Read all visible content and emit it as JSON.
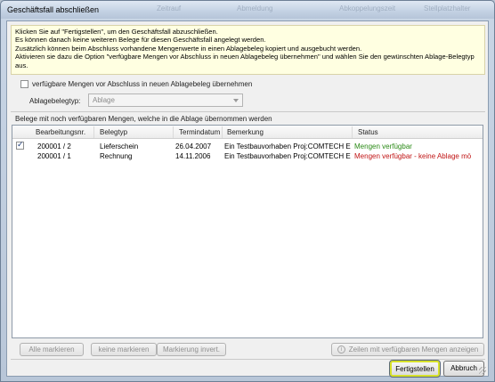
{
  "window": {
    "title": "Geschäftsfall abschließen",
    "background_labels": [
      "Zeitrauf",
      "Abmeldung",
      "Abkoppelungszeit",
      "Stellplatzhalter"
    ]
  },
  "info": {
    "lines": [
      "Klicken Sie auf \"Fertigstellen\", um den Geschäftsfall abzuschließen.",
      "Es können danach keine weiteren Belege für diesen Geschäftsfall angelegt werden.",
      "Zusätzlich können beim Abschluss vorhandene Mengenwerte in einen Ablagebeleg kopiert und ausgebucht werden.",
      "Aktivieren sie dazu die Option \"verfügbare Mengen vor Abschluss in neuen Ablagebeleg übernehmen\" und wählen Sie den gewünschten Ablage-Belegtyp aus."
    ]
  },
  "option": {
    "label": "verfügbare Mengen vor Abschluss in neuen Ablagebeleg übernehmen",
    "checked": false
  },
  "ablage": {
    "label": "Ablagebelegtyp:",
    "value": "Ablage"
  },
  "list": {
    "caption": "Belege mit noch verfügbaren Mengen, welche in die Ablage übernommen werden",
    "columns": [
      "Bearbeitungsnr.",
      "Belegtyp",
      "Termindatum",
      "Bemerkung",
      "Status"
    ],
    "rows": [
      {
        "checked": true,
        "nr": "200001 / 2",
        "typ": "Lieferschein",
        "datum": "26.04.2007",
        "bemerkung": "Ein Testbauvorhaben  Proj:COMTECH E",
        "status": "Mengen verfügbar",
        "status_color": "#2a8a16"
      },
      {
        "checked": false,
        "nr": "200001 / 1",
        "typ": "Rechnung",
        "datum": "14.11.2006",
        "bemerkung": "Ein Testbauvorhaben  Proj:COMTECH E",
        "status": "Mengen verfügbar - keine Ablage mö",
        "status_color": "#c01414"
      }
    ]
  },
  "buttons": {
    "mark_all": "Alle markieren",
    "mark_none": "keine markieren",
    "invert": "Markierung invert.",
    "show_rows": "Zeilen mit verfügbaren Mengen anzeigen",
    "finish": "Fertigstellen",
    "cancel": "Abbruch"
  }
}
